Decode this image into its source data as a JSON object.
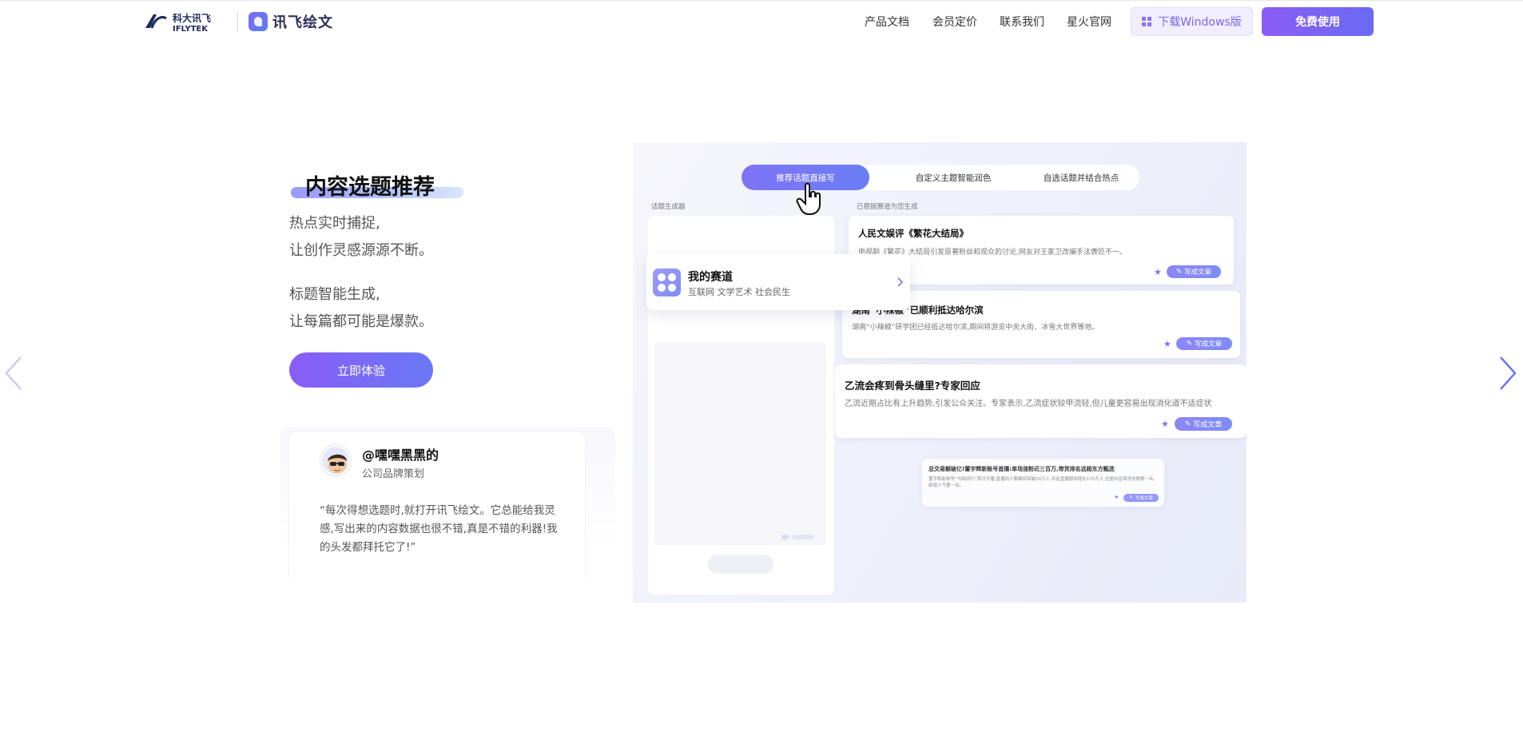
{
  "header": {
    "brand_logo_alt": "IFLYTEK",
    "brand_logo_cn": "科大讯飞",
    "brand_logo_en": "IFLYTEK",
    "app_name": "讯飞绘文",
    "nav": [
      "产品文档",
      "会员定价",
      "联系我们",
      "星火官网"
    ],
    "download_label": "下载Windows版",
    "free_label": "免费使用"
  },
  "feature": {
    "title": "内容选题推荐",
    "desc_lines_1": [
      "热点实时捕捉,",
      "让创作灵感源源不断。"
    ],
    "desc_lines_2": [
      "标题智能生成,",
      "让每篇都可能是爆款。"
    ],
    "cta_label": "立即体验"
  },
  "testimonial": {
    "name": "@嘿嘿黑黑的",
    "role": "公司品牌策划",
    "quote": "“每次得想选题时,就打开讯飞绘文。它总能给我灵感,写出来的内容数据也很不错,真是不错的利器!我的头发都拜托它了!”"
  },
  "mockup": {
    "tabs": [
      "推荐话题直接写",
      "自定义主题智能润色",
      "自选话题并结合热点"
    ],
    "left_label": "话题生成器",
    "right_label": "已根据赛道为您生成",
    "track": {
      "title": "我的赛道",
      "subtitle": "互联网 文学艺术 社会民生"
    },
    "news": [
      {
        "title": "人民文娱评《繁花大结局》",
        "body": "电视剧《繁花》大结局引发原著粉丝和观众的讨论,网友对王家卫改编手法褒贬不一。",
        "btn": "写成文章"
      },
      {
        "title": "湖南“小辣椒”已顺利抵达哈尔滨",
        "body": "湖南“小辣椒”研学团已经抵达哈尔滨,期间将游览中央大街、冰雪大世界等地。",
        "btn": "写成文章"
      },
      {
        "title": "乙流会疼到骨头缝里?专家回应",
        "body": "乙流近期占比有上升趋势,引发公众关注。专家表示,乙流症状较甲流轻,但儿童更容易出现消化道不适症状",
        "btn": "写成文章"
      },
      {
        "title": "总交易额破亿!董宇辉新账号首播:单场涨粉近三百万,带货排名远超东方甄选",
        "body": "董宇辉新账号“与辉同行”首日开播,直播间人数瞬间突破10万人,并在直播期间增长170万人,位居抖音带货总榜第一名,新增人气第一名。",
        "btn": "写成文章"
      }
    ]
  },
  "colors": {
    "accent": "#7b64f0",
    "accent_gradient_start": "#8b5cf6",
    "accent_gradient_end": "#6b6af5"
  }
}
